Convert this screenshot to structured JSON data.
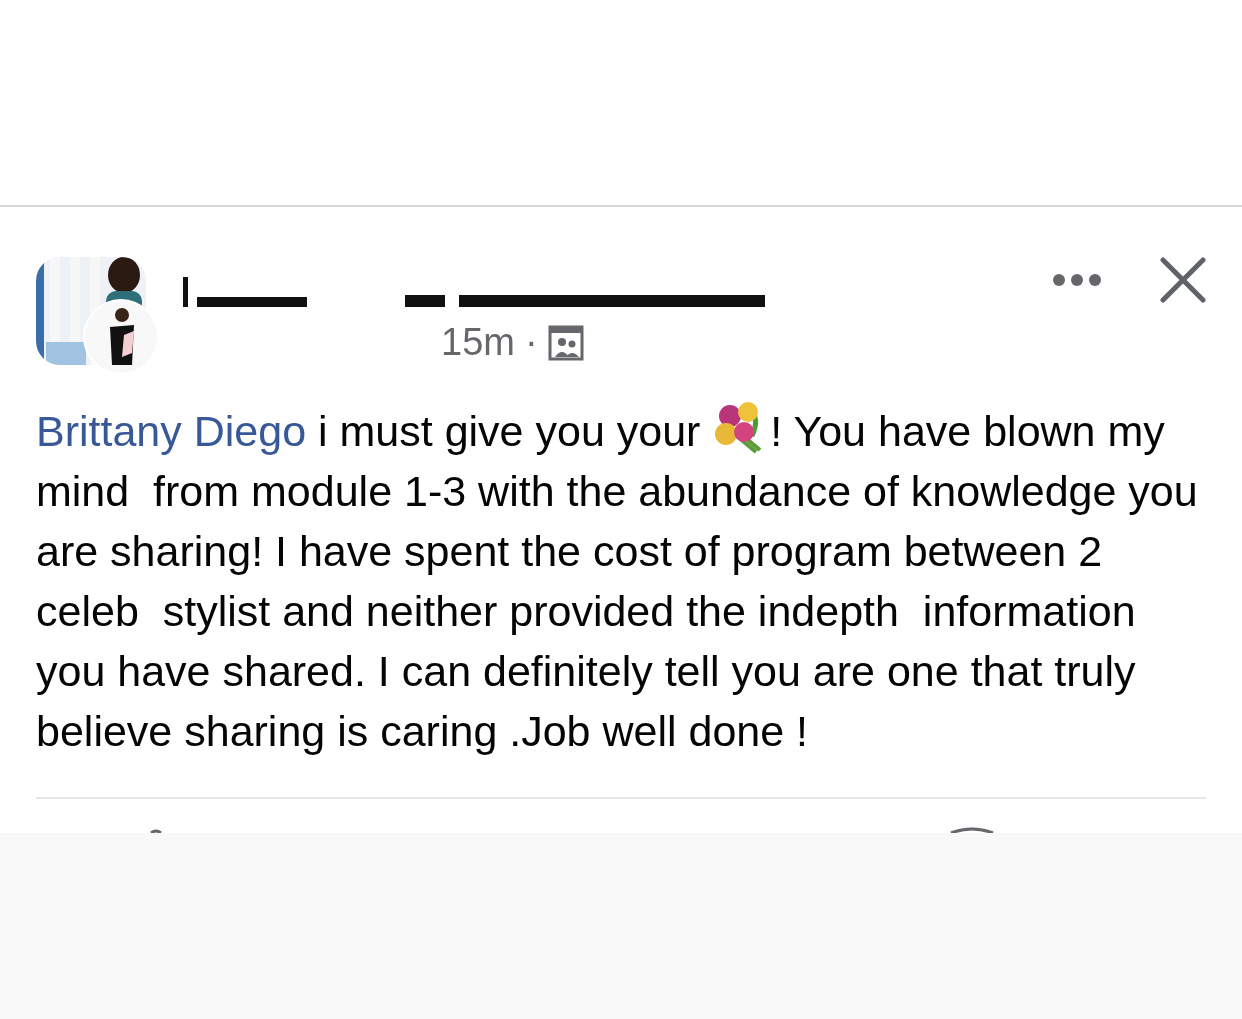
{
  "post": {
    "time": "15m",
    "separator": "·",
    "comment": {
      "mention": "Brittany Diego",
      "text_before_emoji": " i must give you your ",
      "text_after_emoji": "! You have blown my mind  from module 1-3 with the abundance of knowledge you are sharing! I have spent the cost of program between 2 celeb  stylist and neither provided the indepth  information you have shared. I can definitely tell you are one that truly believe sharing is caring .Job well done !"
    }
  }
}
